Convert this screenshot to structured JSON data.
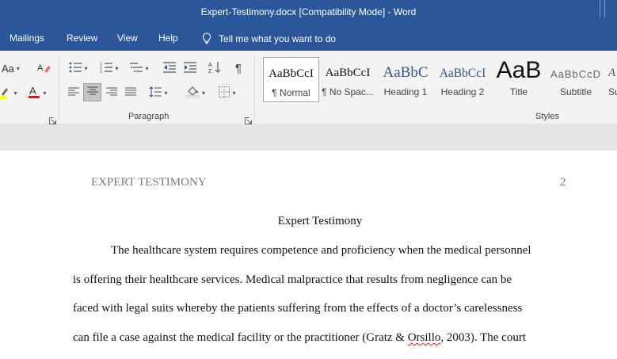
{
  "app": {
    "title": "Expert-Testimony.docx [Compatibility Mode]  -  Word"
  },
  "menu": {
    "items": [
      "Mailings",
      "Review",
      "View",
      "Help"
    ],
    "tell_me": "Tell me what you want to do"
  },
  "ribbon": {
    "font_case_label": "Aa",
    "groups": {
      "paragraph": "Paragraph",
      "styles": "Styles"
    },
    "styles_gallery": [
      {
        "sample": "AaBbCcI",
        "name": "¶ Normal",
        "selected": true
      },
      {
        "sample": "AaBbCcI",
        "name": "¶ No Spac..."
      },
      {
        "sample": "AaBbC",
        "name": "Heading 1"
      },
      {
        "sample": "AaBbCcI",
        "name": "Heading 2"
      },
      {
        "sample": "AaB",
        "name": "Title"
      },
      {
        "sample": "AaBbCcD",
        "name": "Subtitle"
      },
      {
        "sample": "A",
        "name": "Su"
      }
    ],
    "colors": {
      "highlight": "#ffff00",
      "font_color": "#e81123"
    }
  },
  "document": {
    "header_left": "EXPERT TESTIMONY",
    "header_page": "2",
    "title": "Expert Testimony",
    "lines": [
      "The healthcare system requires competence and proficiency when the medical personnel",
      "is offering their healthcare services. Medical malpractice that results from negligence can be",
      "faced with legal suits whereby the patients suffering from the effects of a doctor’s carelessness"
    ],
    "line4_before": "can file a case against the medical facility or the practitioner (Gratz & ",
    "line4_flagged": "Orsillo",
    "line4_after": ", 2003). The court"
  },
  "theme": {
    "accent": "#2b579a"
  }
}
